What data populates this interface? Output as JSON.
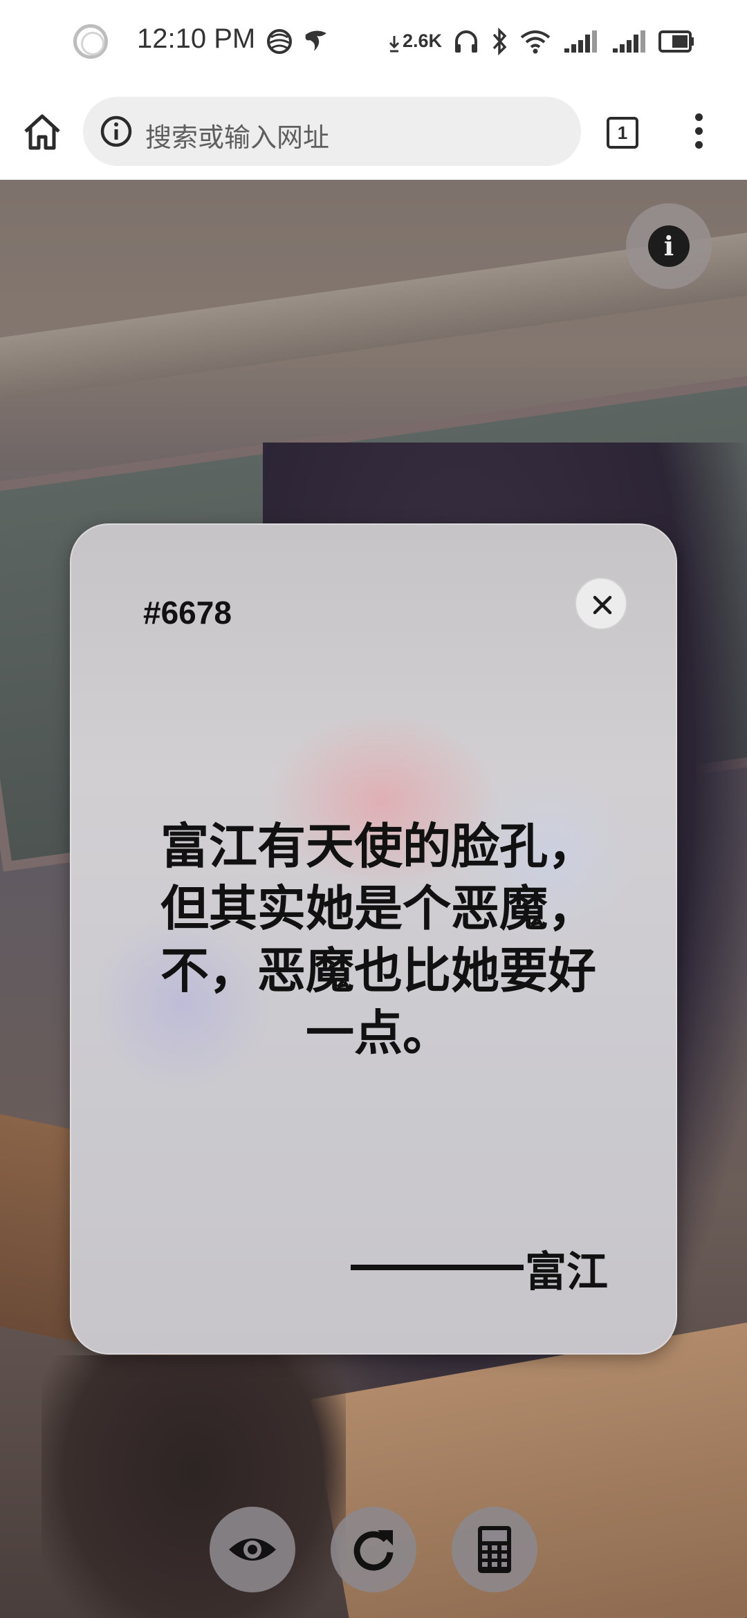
{
  "status_bar": {
    "time": "12:10 PM",
    "net_speed": "2.6K",
    "icons": [
      "assistant-ring-icon",
      "app-notification-icon",
      "signal-app-icon",
      "headphones-icon",
      "bluetooth-icon",
      "wifi-icon",
      "cell-signal-1-icon",
      "cell-signal-2-icon",
      "battery-icon"
    ]
  },
  "browser": {
    "url_placeholder": "搜索或输入网址",
    "tab_count": "1",
    "icons": {
      "home": "home-icon",
      "info": "info-icon",
      "menu": "more-vert-icon"
    }
  },
  "page": {
    "info_button_icon": "info-icon",
    "card": {
      "id": "#6678",
      "quote_lines": [
        "富江有天使的脸孔，",
        "但其实她是个恶魔，",
        "不，恶魔也比她要好",
        "一点。"
      ],
      "author": "富江",
      "author_prefix": "———",
      "close_icon": "close-icon"
    },
    "bottom_buttons": [
      {
        "icon": "eye-icon"
      },
      {
        "icon": "refresh-icon"
      },
      {
        "icon": "calculator-icon"
      }
    ]
  },
  "colors": {
    "card_background": "#cdcbce",
    "text": "#111111",
    "button_background": "#8c878c"
  }
}
